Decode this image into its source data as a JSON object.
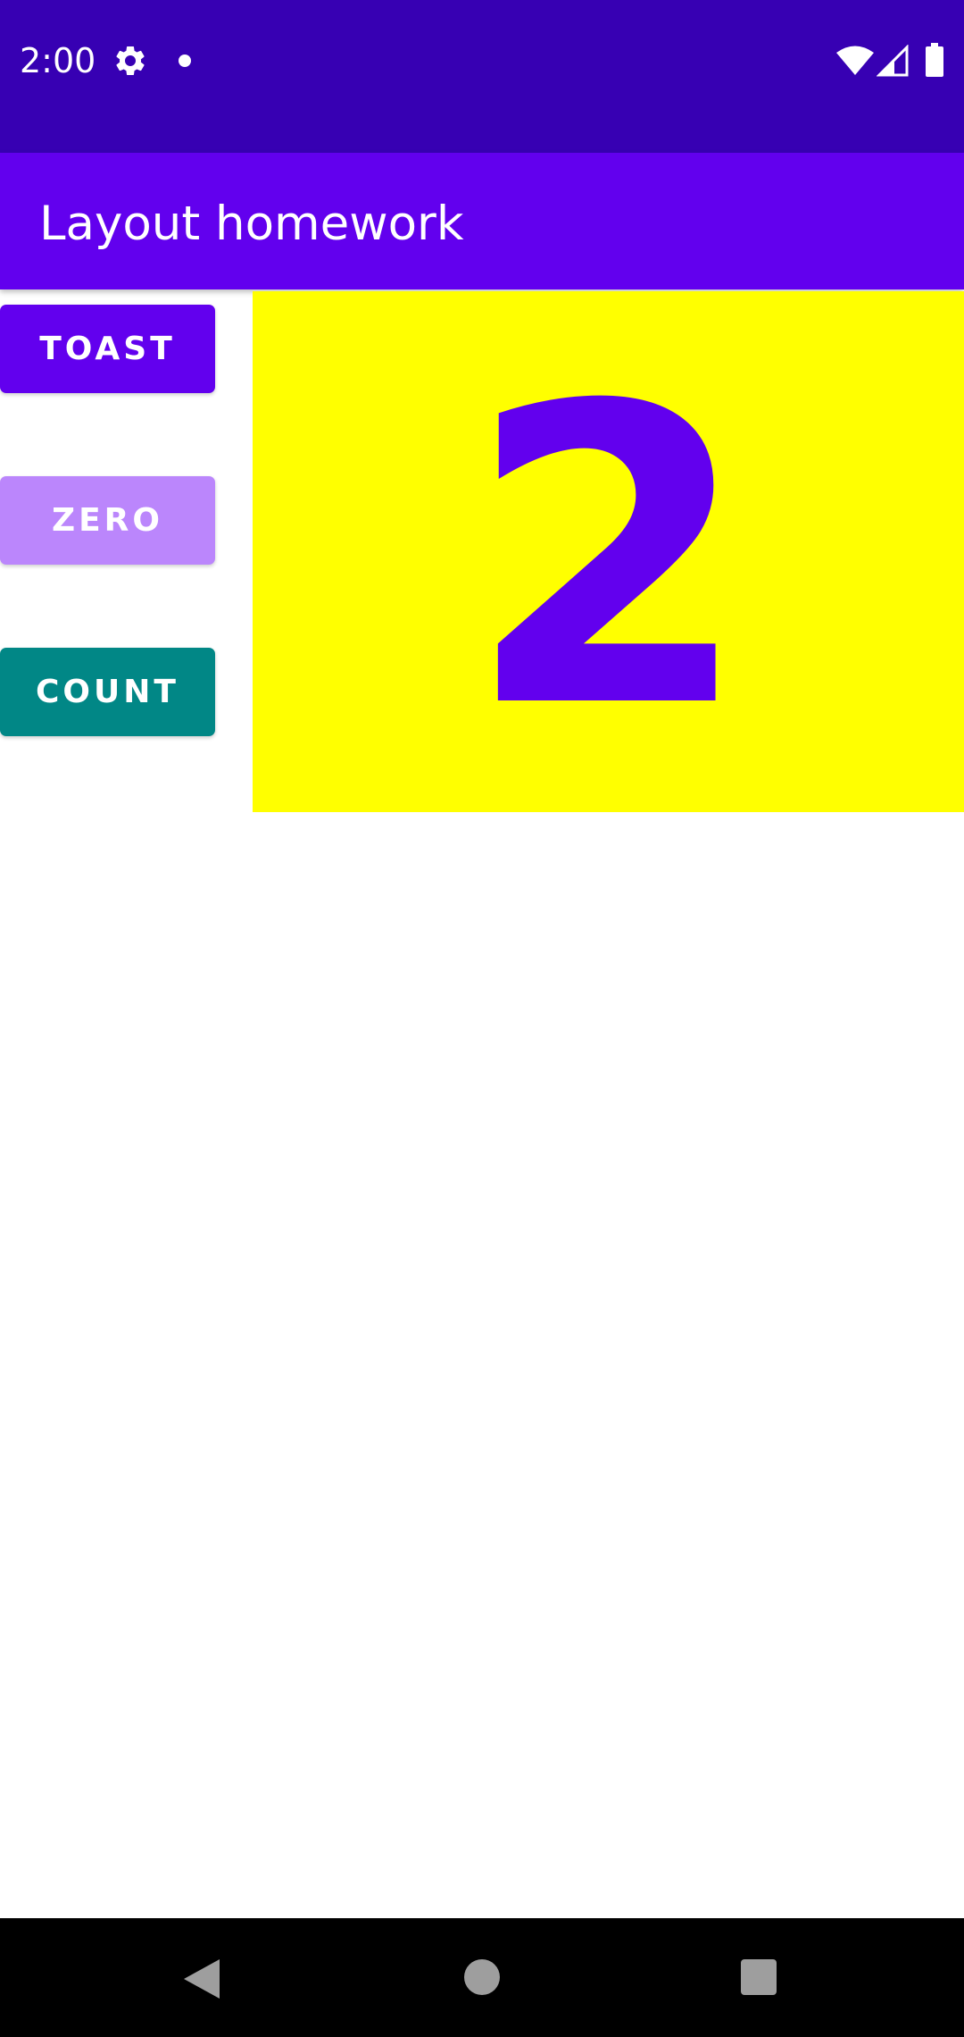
{
  "status_bar": {
    "time": "2:00",
    "icons": [
      "gear-icon",
      "dot-icon",
      "wifi-icon",
      "signal-icon",
      "battery-icon"
    ]
  },
  "app_bar": {
    "title": "Layout homework"
  },
  "buttons": {
    "toast_label": "TOAST",
    "zero_label": "ZERO",
    "count_label": "COUNT"
  },
  "counter": {
    "value": "2"
  },
  "nav_bar": {
    "icons": [
      "back-icon",
      "home-icon",
      "recents-icon"
    ]
  },
  "colors": {
    "status_bar": "#3700B3",
    "primary": "#6200EE",
    "zero_button": "#BB86FC",
    "count_button": "#018786",
    "count_background": "#FFFF00"
  }
}
